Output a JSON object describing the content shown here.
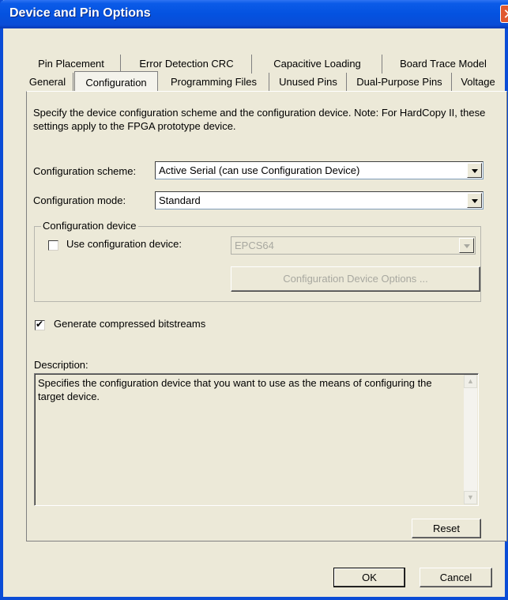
{
  "window": {
    "title": "Device and Pin Options"
  },
  "tabs": {
    "back_row": [
      "Pin Placement",
      "Error Detection CRC",
      "Capacitive Loading",
      "Board Trace Model"
    ],
    "front_row": [
      "General",
      "Configuration",
      "Programming Files",
      "Unused Pins",
      "Dual-Purpose Pins",
      "Voltage"
    ],
    "active": "Configuration"
  },
  "panel": {
    "intro": "Specify the device configuration scheme and the configuration device. Note: For HardCopy II, these settings apply to the FPGA prototype device.",
    "scheme_label": "Configuration scheme:",
    "scheme_value": "Active Serial (can use Configuration Device)",
    "mode_label": "Configuration mode:",
    "mode_value": "Standard",
    "group_label": "Configuration device",
    "use_device_label": "Use configuration device:",
    "use_device_checked": false,
    "device_value": "EPCS64",
    "device_options_button": "Configuration Device Options ...",
    "compress_label": "Generate compressed bitstreams",
    "compress_checked": true,
    "description_label": "Description:",
    "description_text": "Specifies the configuration device that you want to use as the means of configuring the target device.",
    "reset_button": "Reset"
  },
  "footer": {
    "ok_button": "OK",
    "cancel_button": "Cancel"
  }
}
